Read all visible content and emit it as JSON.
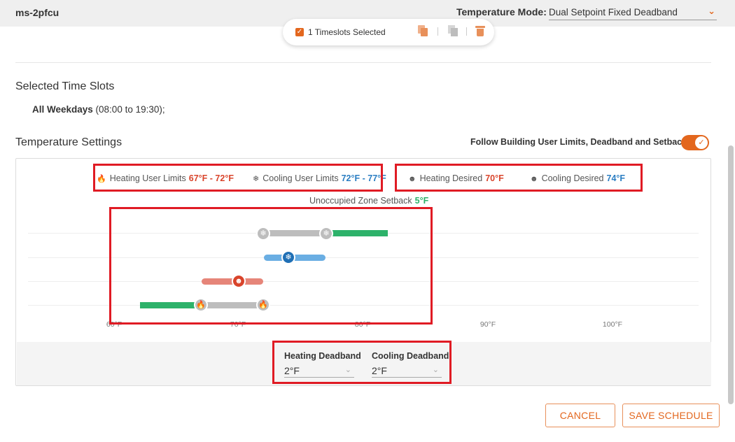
{
  "header": {
    "device_name": "ms-2pfcu",
    "mode_label": "Temperature Mode:",
    "mode_value": "Dual Setpoint Fixed Deadband",
    "chevron_icon": "chevron-down-icon"
  },
  "timeslots": {
    "selected_label": "1 Timeslots Selected",
    "checked": true,
    "actions": [
      "copy-icon",
      "paste-icon",
      "trash-icon"
    ]
  },
  "selected_slots": {
    "heading": "Selected Time Slots",
    "days_bold": "All Weekdays",
    "days_detail": " (08:00 to 19:30);"
  },
  "temperature_settings": {
    "heading": "Temperature Settings",
    "follow_label": "Follow Building User Limits, Deadband and Setback",
    "follow_enabled": true
  },
  "legend": {
    "heating_limits_label": "Heating User Limits",
    "heating_limits_value": "67°F - 72°F",
    "cooling_limits_label": "Cooling User Limits",
    "cooling_limits_value": "72°F - 77°F",
    "heating_desired_label": "Heating Desired",
    "heating_desired_value": "70°F",
    "cooling_desired_label": "Cooling Desired",
    "cooling_desired_value": "74°F",
    "setback_label": "Unoccupied Zone Setback",
    "setback_value": "5°F"
  },
  "scale": {
    "ticks": [
      "60°F",
      "70°F",
      "80°F",
      "90°F",
      "100°F"
    ]
  },
  "colors": {
    "accent": "#e3671e",
    "heating": "#d9442b",
    "cooling": "#2a7dc2",
    "setback": "#2db26a",
    "limits": "#bdbdbd"
  },
  "deadband": {
    "heating_label": "Heating Deadband",
    "heating_value": "2°F",
    "cooling_label": "Cooling Deadband",
    "cooling_value": "2°F"
  },
  "buttons": {
    "cancel": "CANCEL",
    "save": "SAVE SCHEDULE"
  }
}
